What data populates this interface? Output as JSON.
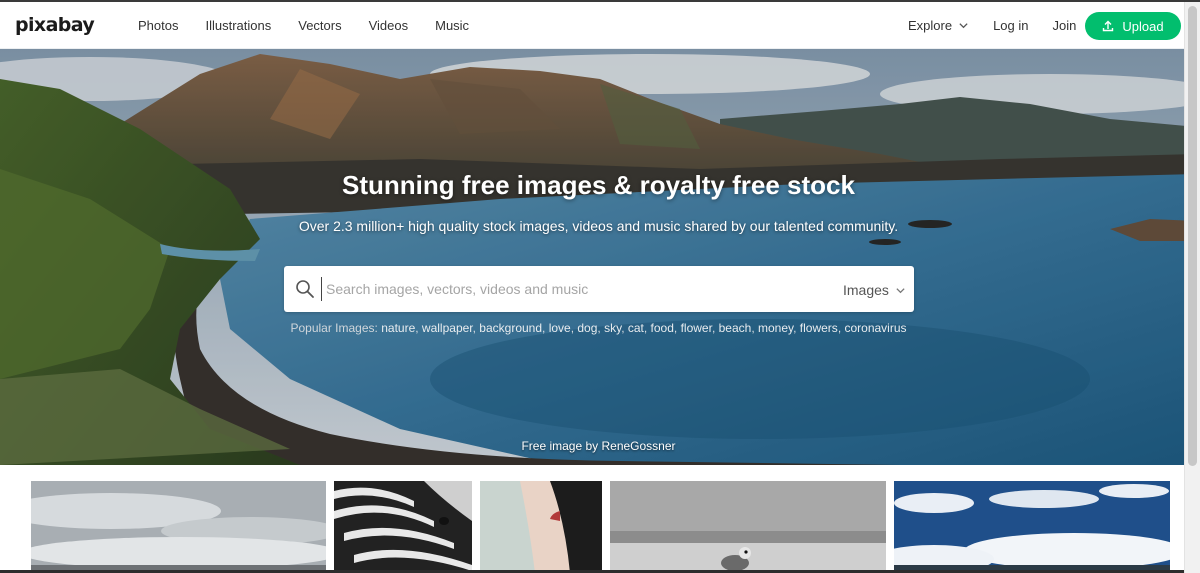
{
  "header": {
    "logo": "pixabay",
    "nav": [
      "Photos",
      "Illustrations",
      "Vectors",
      "Videos",
      "Music"
    ],
    "explore": "Explore",
    "login": "Log in",
    "join": "Join",
    "upload": "Upload"
  },
  "hero": {
    "title": "Stunning free images & royalty free stock",
    "subtitle": "Over 2.3 million+ high quality stock images, videos and music shared by our talented community.",
    "search": {
      "placeholder": "Search images, vectors, videos and music",
      "value": "",
      "type_selected": "Images"
    },
    "popular_label": "Popular Images:",
    "popular_tags": [
      "nature",
      "wallpaper",
      "background",
      "love",
      "dog",
      "sky",
      "cat",
      "food",
      "flower",
      "beach",
      "money",
      "flowers",
      "coronavirus"
    ],
    "credit": "Free image by ReneGossner"
  },
  "colors": {
    "accent": "#02be6e",
    "lake": "#3d7fa6",
    "sky": "#c9d6e0"
  },
  "icons": {
    "search": "search-icon",
    "upload": "upload-icon",
    "chevron": "chevron-down-icon"
  }
}
